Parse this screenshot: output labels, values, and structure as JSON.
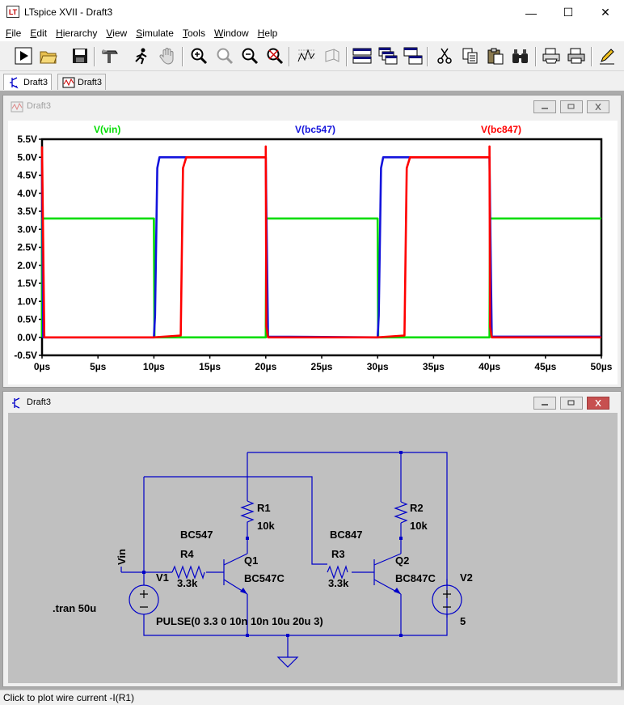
{
  "app": {
    "title": "LTspice XVII - Draft3",
    "icon_label": "LT"
  },
  "window_controls": {
    "minimize": "—",
    "maximize": "☐",
    "close": "✕"
  },
  "menu": [
    {
      "accel": "F",
      "rest": "ile"
    },
    {
      "accel": "E",
      "rest": "dit"
    },
    {
      "accel": "H",
      "rest": "ierarchy"
    },
    {
      "accel": "V",
      "rest": "iew"
    },
    {
      "accel": "S",
      "rest": "imulate"
    },
    {
      "accel": "T",
      "rest": "ools"
    },
    {
      "accel": "W",
      "rest": "indow"
    },
    {
      "accel": "H",
      "rest": "elp"
    }
  ],
  "toolbar_icons": [
    "run-icon",
    "open-icon",
    "save-icon",
    "control-panel-icon",
    "run-man-icon",
    "pan-hand-icon",
    "zoom-in-icon",
    "zoom-area-icon",
    "zoom-out-icon",
    "zoom-cancel-icon",
    "autorange-icon",
    "fft-icon",
    "tile-horizontal-icon",
    "cascade-icon",
    "tile-vertical-icon",
    "cut-icon",
    "copy-icon",
    "paste-icon",
    "find-icon",
    "print-setup-icon",
    "print-icon",
    "pencil-icon"
  ],
  "tabs": [
    {
      "label": "Draft3",
      "icon": "schematic-icon"
    },
    {
      "label": "Draft3",
      "icon": "waveform-icon"
    }
  ],
  "plot_window": {
    "title": "Draft3"
  },
  "schematic_window": {
    "title": "Draft3"
  },
  "colors": {
    "vin": "#00dd00",
    "bc547": "#1414dc",
    "bc847": "#ff0000",
    "wire": "#0000c8",
    "sch_bg": "#c0c0c0",
    "label": "#000000"
  },
  "chart_data": {
    "type": "line",
    "xlabel": "",
    "ylabel": "",
    "xlim": [
      0,
      50
    ],
    "ylim": [
      -0.5,
      5.5
    ],
    "x_ticks": [
      "0µs",
      "5µs",
      "10µs",
      "15µs",
      "20µs",
      "25µs",
      "30µs",
      "35µs",
      "40µs",
      "45µs",
      "50µs"
    ],
    "x_tick_values": [
      0,
      5,
      10,
      15,
      20,
      25,
      30,
      35,
      40,
      45,
      50
    ],
    "y_ticks": [
      "5.5V",
      "5.0V",
      "4.5V",
      "4.0V",
      "3.5V",
      "3.0V",
      "2.5V",
      "2.0V",
      "1.5V",
      "1.0V",
      "0.5V",
      "0.0V",
      "-0.5V"
    ],
    "y_tick_values": [
      5.5,
      5.0,
      4.5,
      4.0,
      3.5,
      3.0,
      2.5,
      2.0,
      1.5,
      1.0,
      0.5,
      0.0,
      -0.5
    ],
    "grid": false,
    "legend_position": "top",
    "series": [
      {
        "name": "V(vin)",
        "x": [
          0,
          0,
          10,
          10.05,
          20,
          20.05,
          30,
          30.05,
          40,
          40.05,
          50
        ],
        "y": [
          0,
          3.3,
          3.3,
          0,
          0,
          3.3,
          3.3,
          0,
          0,
          3.3,
          3.3
        ]
      },
      {
        "name": "V(bc547)",
        "x": [
          0,
          0.1,
          10,
          10.1,
          10.3,
          10.5,
          20,
          20.05,
          20.2,
          30,
          30.1,
          30.3,
          30.5,
          40,
          40.05,
          40.2,
          50
        ],
        "y": [
          5.0,
          0,
          0,
          0.6,
          4.7,
          5.0,
          5.0,
          3.6,
          0.02,
          0,
          0.6,
          4.7,
          5.0,
          5.0,
          3.6,
          0.02,
          0.02
        ]
      },
      {
        "name": "V(bc847)",
        "x": [
          0,
          0,
          0.2,
          10,
          12.4,
          12.6,
          12.9,
          20,
          20,
          20.05,
          20.2,
          30,
          32.4,
          32.6,
          32.9,
          40,
          40,
          40.05,
          40.2,
          50
        ],
        "y": [
          5.3,
          5.3,
          0,
          0,
          0.05,
          4.7,
          5.0,
          5.0,
          5.3,
          0.3,
          0,
          0,
          0.05,
          4.7,
          5.0,
          5.0,
          5.3,
          0.3,
          0,
          0
        ]
      }
    ]
  },
  "schematic": {
    "net_vin": "Vin",
    "r1": {
      "name": "R1",
      "value": "10k"
    },
    "r2": {
      "name": "R2",
      "value": "10k"
    },
    "r3": {
      "name": "R3",
      "value": "3.3k"
    },
    "r4": {
      "name": "R4",
      "value": "3.3k"
    },
    "q1": {
      "name": "Q1",
      "model": "BC547C",
      "net": "BC547"
    },
    "q2": {
      "name": "Q2",
      "model": "BC847C",
      "net": "BC847"
    },
    "v1": {
      "name": "V1",
      "value": "PULSE(0 3.3 0 10n 10n 10u 20u 3)"
    },
    "v2": {
      "name": "V2",
      "value": "5"
    },
    "directive": ".tran 50u"
  },
  "status": "Click to plot wire current -I(R1)"
}
